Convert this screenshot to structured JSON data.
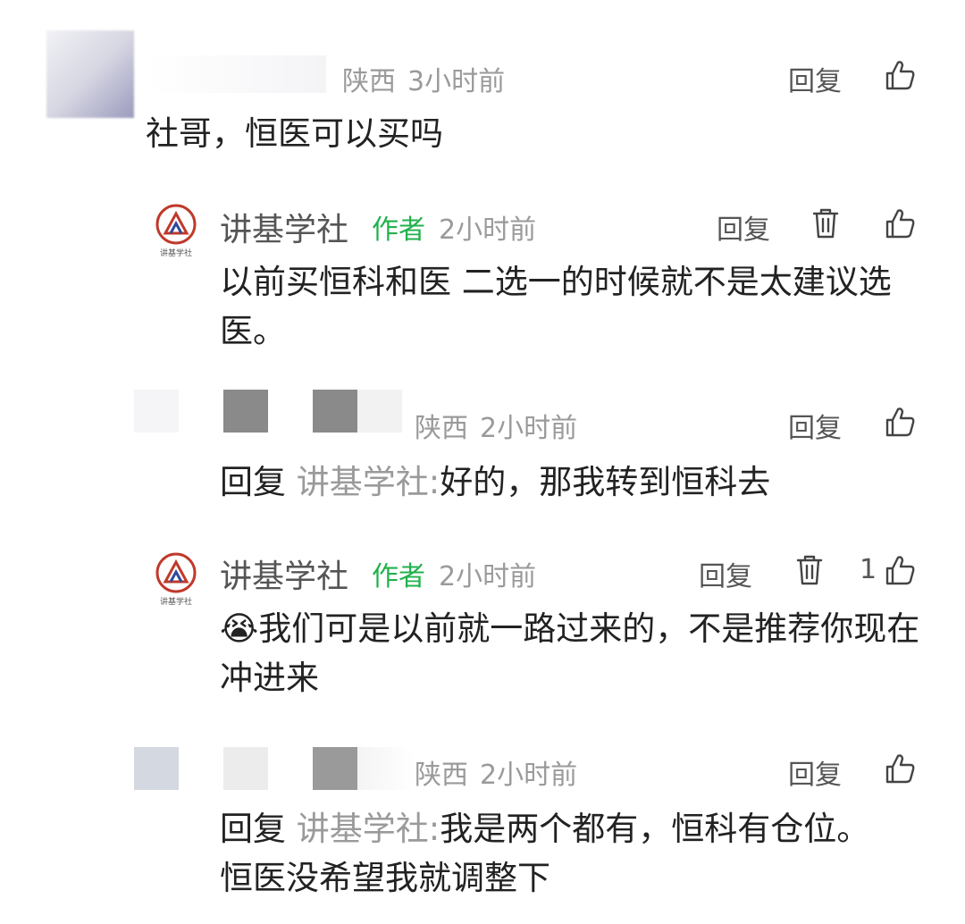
{
  "comments": [
    {
      "location": "陕西",
      "time": "3小时前",
      "reply_label": "回复",
      "text": "社哥，恒医可以买吗"
    },
    {
      "author": "讲基学社",
      "tag": "作者",
      "time": "2小时前",
      "reply_label": "回复",
      "logo_text": "讲基学社",
      "text": "以前买恒科和医 二选一的时候就不是太建议选医。"
    },
    {
      "location": "陕西",
      "time": "2小时前",
      "reply_label": "回复",
      "reply_prefix": "回复",
      "reply_to": "讲基学社:",
      "text": "好的，那我转到恒科去"
    },
    {
      "author": "讲基学社",
      "tag": "作者",
      "time": "2小时前",
      "reply_label": "回复",
      "like_count": "1",
      "logo_text": "讲基学社",
      "emoji": "😭",
      "text": "我们可是以前就一路过来的，不是推荐你现在冲进来"
    },
    {
      "location": "陕西",
      "time": "2小时前",
      "reply_label": "回复",
      "reply_prefix": "回复",
      "reply_to": "讲基学社:",
      "text": "我是两个都有，恒科有仓位。恒医没希望我就调整下"
    }
  ],
  "icons": {
    "like": "thumbs-up-icon",
    "delete": "trash-icon"
  }
}
